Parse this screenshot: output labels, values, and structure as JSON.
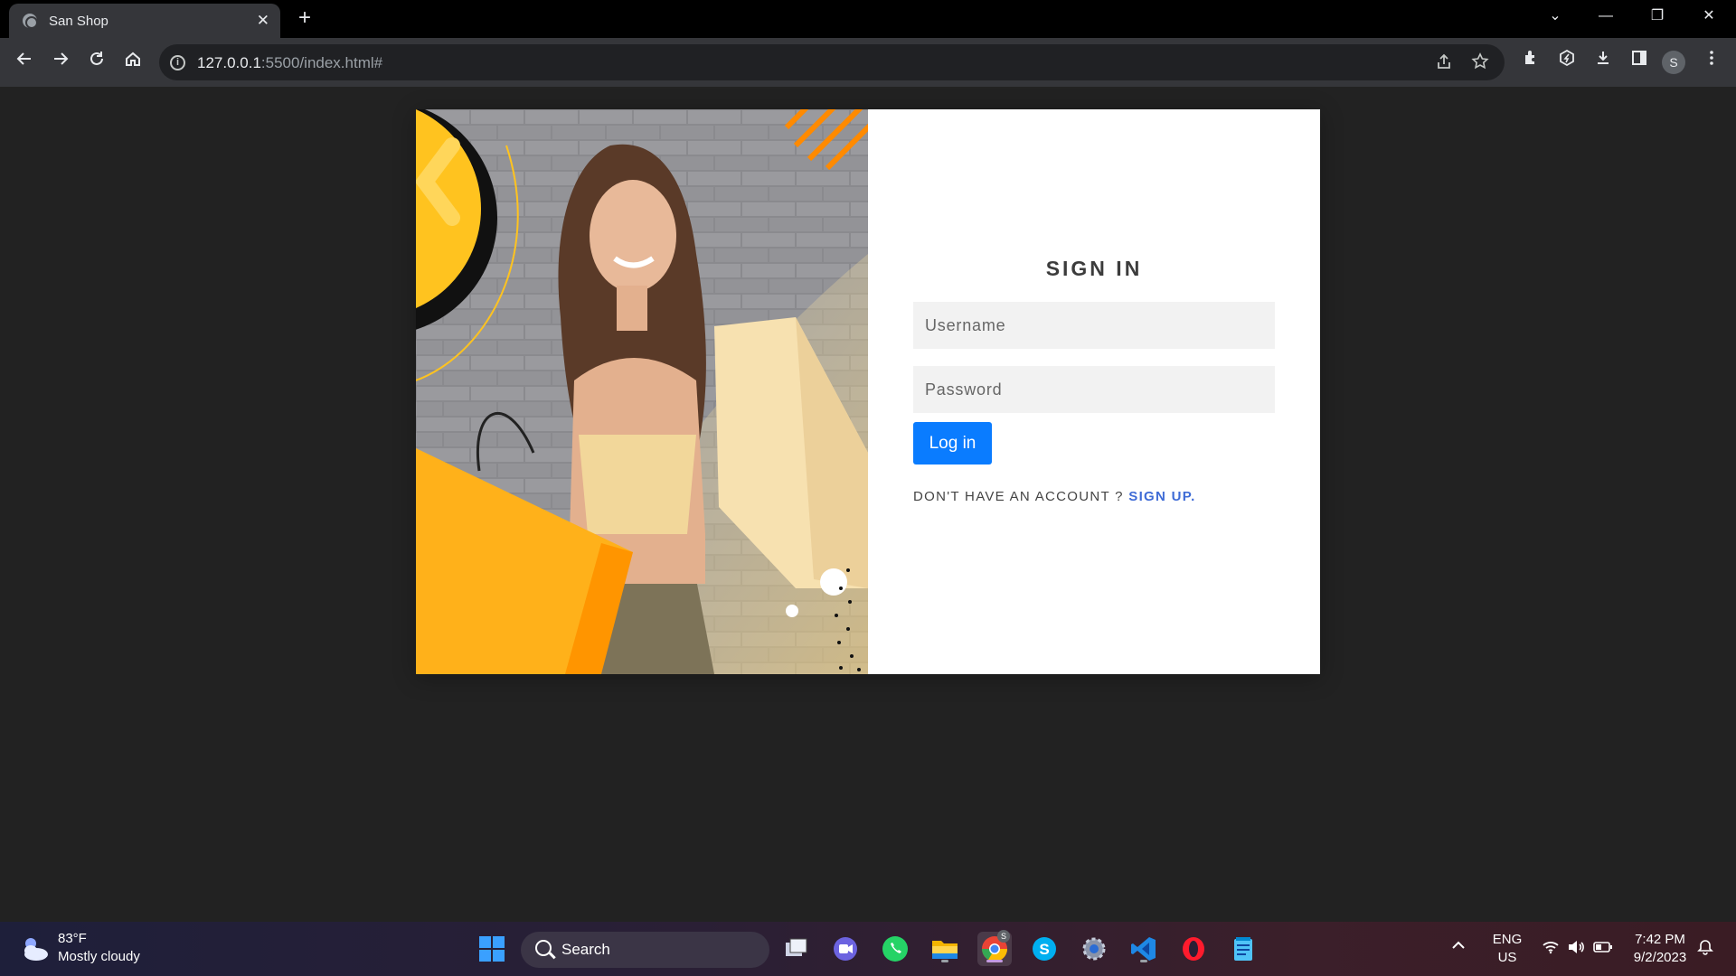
{
  "browser": {
    "tab_title": "San Shop",
    "tab_close": "✕",
    "new_tab": "+",
    "url_host": "127.0.0.1",
    "url_rest": ":5500/index.html#",
    "profile_initial": "S"
  },
  "window_controls": {
    "chevron": "⌄",
    "minimize": "—",
    "restore": "❐",
    "close": "✕"
  },
  "page": {
    "signin_title": "SIGN IN",
    "username_placeholder": "Username",
    "password_placeholder": "Password",
    "login_button": "Log in",
    "no_account_text": "DON'T HAVE AN ACCOUNT ?",
    "signup_link": "SIGN UP."
  },
  "taskbar": {
    "weather_temp": "83°F",
    "weather_desc": "Mostly cloudy",
    "search_label": "Search",
    "lang_top": "ENG",
    "lang_bottom": "US",
    "time": "7:42 PM",
    "date": "9/2/2023",
    "chrome_badge": "S"
  },
  "colors": {
    "accent_button": "#0a7cff",
    "signup_link": "#3e6bd6",
    "hero_yellow": "#ffc31f",
    "hero_orange": "#ff8a00"
  }
}
